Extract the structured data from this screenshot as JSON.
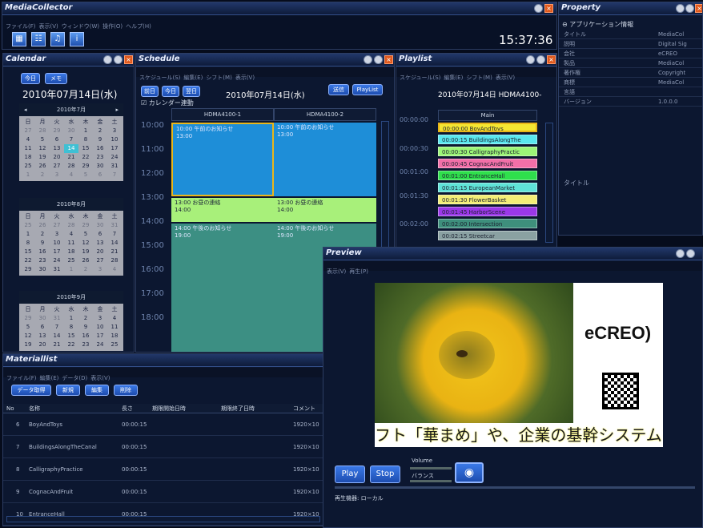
{
  "main": {
    "title": "MediaCollector",
    "menu": [
      "ファイル(F)",
      "表示(V)",
      "ウィンドウ(W)",
      "操作(O)",
      "ヘルプ(H)"
    ],
    "clock": "15:37:36"
  },
  "calendar": {
    "title": "Calendar",
    "today": "今日",
    "memo": "メモ",
    "date": "2010年07月14日(水)",
    "months": [
      {
        "label": "2010年7月",
        "days": [
          "日",
          "月",
          "火",
          "水",
          "木",
          "金",
          "土"
        ],
        "cells": [
          "27",
          "28",
          "29",
          "30",
          "1",
          "2",
          "3",
          "4",
          "5",
          "6",
          "7",
          "8",
          "9",
          "10",
          "11",
          "12",
          "13",
          "14",
          "15",
          "16",
          "17",
          "18",
          "19",
          "20",
          "21",
          "22",
          "23",
          "24",
          "25",
          "26",
          "27",
          "28",
          "29",
          "30",
          "31",
          "1",
          "2",
          "3",
          "4",
          "5",
          "6",
          "7"
        ]
      },
      {
        "label": "2010年8月",
        "days": [
          "日",
          "月",
          "火",
          "水",
          "木",
          "金",
          "土"
        ],
        "cells": [
          "25",
          "26",
          "27",
          "28",
          "29",
          "30",
          "31",
          "1",
          "2",
          "3",
          "4",
          "5",
          "6",
          "7",
          "8",
          "9",
          "10",
          "11",
          "12",
          "13",
          "14",
          "15",
          "16",
          "17",
          "18",
          "19",
          "20",
          "21",
          "22",
          "23",
          "24",
          "25",
          "26",
          "27",
          "28",
          "29",
          "30",
          "31",
          "1",
          "2",
          "3",
          "4"
        ]
      },
      {
        "label": "2010年9月",
        "days": [
          "日",
          "月",
          "火",
          "水",
          "木",
          "金",
          "土"
        ],
        "cells": [
          "29",
          "30",
          "31",
          "1",
          "2",
          "3",
          "4",
          "5",
          "6",
          "7",
          "8",
          "9",
          "10",
          "11",
          "12",
          "13",
          "14",
          "15",
          "16",
          "17",
          "18",
          "19",
          "20",
          "21",
          "22",
          "23",
          "24",
          "25"
        ]
      }
    ]
  },
  "schedule": {
    "title": "Schedule",
    "menu": [
      "スケジュール(S)",
      "編集(E)",
      "シフト(M)",
      "表示(V)"
    ],
    "prev": "前日",
    "today": "今日",
    "next": "翌日",
    "send": "送信",
    "playlist": "PlayList",
    "date": "2010年07月14日(水)",
    "cal_link": "カレンダー連動",
    "times": [
      "10:00",
      "11:00",
      "12:00",
      "13:00",
      "14:00",
      "15:00",
      "16:00",
      "17:00",
      "18:00"
    ],
    "cols": [
      "HDMA4100-1",
      "HDMA4100-2"
    ],
    "events": [
      {
        "t": "10:00 午前のお知らせ",
        "e": "13:00"
      },
      {
        "t": "13:00 お昼の連絡",
        "e": "14:00"
      },
      {
        "t": "14:00 午後のお知らせ",
        "e": "19:00"
      }
    ]
  },
  "playlist": {
    "title": "Playlist",
    "menu": [
      "スケジュール(S)",
      "編集(E)",
      "シフト(M)",
      "表示(V)"
    ],
    "header": "2010年07月14日 HDMA4100-",
    "col": "Main",
    "times": [
      "00:00:00",
      "00:00:30",
      "00:01:00",
      "00:01:30",
      "00:02:00"
    ],
    "items": [
      {
        "label": "00:00:00 BoyAndToys",
        "color": "#f4e632"
      },
      {
        "label": "00:00:15 BuildingsAlongThe",
        "color": "#59e7ee"
      },
      {
        "label": "00:00:30 CalligraphyPractic",
        "color": "#9cf577"
      },
      {
        "label": "00:00:45 CognacAndFruit",
        "color": "#f26fa8"
      },
      {
        "label": "00:01:00 EntranceHall",
        "color": "#2fe04c"
      },
      {
        "label": "00:01:15 EuropeanMarket",
        "color": "#5fe3d7"
      },
      {
        "label": "00:01:30 FlowerBasket",
        "color": "#f3ee76"
      },
      {
        "label": "00:01:45 HarborScene",
        "color": "#9b38e8"
      },
      {
        "label": "00:02:00 Intersection",
        "color": "#3e8f7c"
      },
      {
        "label": "00:02:15 Streetcar",
        "color": "#8aa1a2"
      }
    ]
  },
  "property": {
    "title": "Property",
    "section": "アプリケーション情報",
    "rows": [
      [
        "タイトル",
        "MediaCol"
      ],
      [
        "説明",
        "Digital Sig"
      ],
      [
        "会社",
        "eCREO"
      ],
      [
        "製品",
        "MediaCol"
      ],
      [
        "著作権",
        "Copyright"
      ],
      [
        "商標",
        "MediaCol"
      ],
      [
        "言語",
        ""
      ],
      [
        "バージョン",
        "1.0.0.0"
      ]
    ],
    "footer": "タイトル"
  },
  "materials": {
    "title": "Materiallist",
    "menu": [
      "ファイル(F)",
      "編集(E)",
      "データ(D)",
      "表示(V)"
    ],
    "btns": [
      "データ取得",
      "新規",
      "編集",
      "削除"
    ],
    "cols": [
      "No",
      "名称",
      "長さ",
      "期限開始日時",
      "期限終了日時",
      "コメント"
    ],
    "rows": [
      {
        "no": "6",
        "name": "BoyAndToys",
        "len": "00:00:15",
        "c": "1920×10"
      },
      {
        "no": "7",
        "name": "BuildingsAlongTheCanal",
        "len": "00:00:15",
        "c": "1920×10"
      },
      {
        "no": "8",
        "name": "CalligraphyPractice",
        "len": "00:00:15",
        "c": "1920×10"
      },
      {
        "no": "9",
        "name": "CognacAndFruit",
        "len": "00:00:15",
        "c": "1920×10"
      },
      {
        "no": "10",
        "name": "EntranceHall",
        "len": "00:00:15",
        "c": "1920×10"
      }
    ]
  },
  "preview": {
    "title": "Preview",
    "menu": [
      "表示(V)",
      "再生(P)"
    ],
    "logo": "eCREO)",
    "ticker": "フト「華まめ」や、企業の基幹システムを",
    "play": "Play",
    "stop": "Stop",
    "volume": "Volume",
    "balance": "バランス",
    "device": "再生機器: ローカル"
  },
  "colors": {
    "accent": "#1e5bd4",
    "titlebar": "#1a2e5a",
    "close": "#e05a1e"
  },
  "icons": [
    "toolbar-calendar-icon",
    "toolbar-schedule-icon",
    "toolbar-material-icon",
    "toolbar-info-icon",
    "minimize-icon",
    "maximize-icon",
    "close-icon",
    "camera-icon",
    "qr-icon",
    "bee-photo"
  ]
}
